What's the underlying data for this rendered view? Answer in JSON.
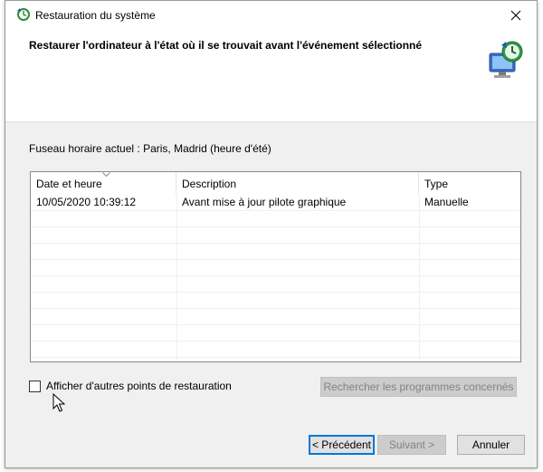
{
  "window": {
    "title": "Restauration du système",
    "close_icon": "close-icon"
  },
  "header": {
    "title": "Restaurer l'ordinateur à l'état où il se trouvait avant l'événement sélectionné",
    "icon": "system-restore-icon"
  },
  "timezone": "Fuseau horaire actuel : Paris, Madrid (heure d'été)",
  "table": {
    "columns": [
      "Date et heure",
      "Description",
      "Type"
    ],
    "rows": [
      [
        "10/05/2020 10:39:12",
        "Avant mise à jour pilote graphique",
        "Manuelle"
      ]
    ]
  },
  "show_more": {
    "label": "Afficher d'autres points de restauration",
    "checked": false
  },
  "buttons": {
    "scan": "Rechercher les programmes concernés",
    "back": "< Précédent",
    "next": "Suivant >",
    "cancel": "Annuler"
  },
  "colors": {
    "accent": "#0078d7",
    "dialog_bg": "#f0f0f0"
  }
}
